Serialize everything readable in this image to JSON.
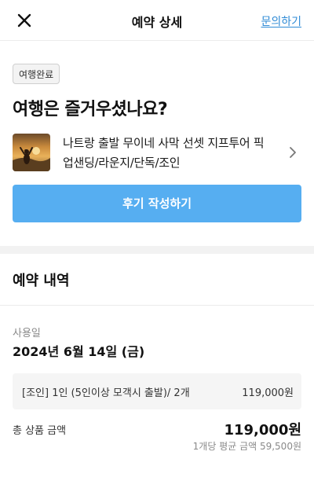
{
  "header": {
    "title": "예약 상세",
    "inquiry_label": "문의하기",
    "close_icon": "close-icon"
  },
  "status": {
    "badge": "여행완료",
    "heading": "여행은 즐거우셨나요?"
  },
  "product": {
    "name_line1": "나트랑 출발 무이네 사막 선셋 지프투어 픽",
    "name_line2": "업샌딩/라운지/단독/조인",
    "chevron_icon": "chevron-right-icon"
  },
  "review_button": {
    "label": "후기 작성하기",
    "color": "#56aef1"
  },
  "reservation": {
    "section_title": "예약 내역",
    "use_date_label": "사용일",
    "use_date_value": "2024년 6월 14일 (금)",
    "option": {
      "text": "[조인] 1인 (5인이상 모객시 출발)/ 2개",
      "price": "119,000원"
    },
    "total_label": "총 상품 금액",
    "total_value": "119,000원",
    "avg_price": "1개당 평균 금액 59,500원"
  }
}
